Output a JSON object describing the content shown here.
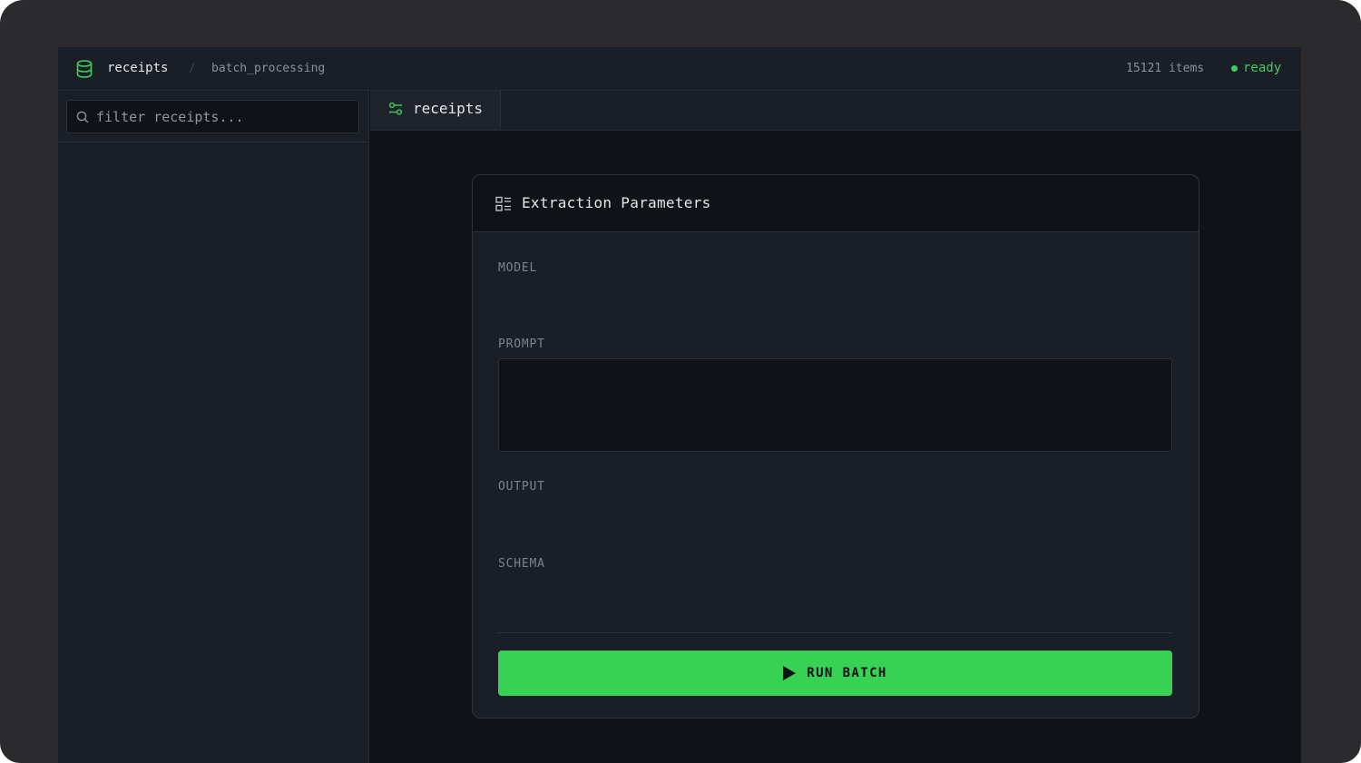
{
  "header": {
    "breadcrumb_root": "receipts",
    "breadcrumb_separator": "/",
    "breadcrumb_leaf": "batch_processing",
    "item_count": "15121 items",
    "status": "ready",
    "database_icon": "database-icon",
    "status_color": "#3ecf5a"
  },
  "sidebar": {
    "search_placeholder": "filter receipts...",
    "search_value": "",
    "search_icon": "search-icon"
  },
  "tabs": [
    {
      "label": "receipts",
      "icon": "sliders-icon",
      "active": true
    }
  ],
  "card": {
    "title": "Extraction Parameters",
    "icon": "form-list-icon",
    "fields": {
      "model_label": "MODEL",
      "prompt_label": "PROMPT",
      "prompt_value": "",
      "output_label": "OUTPUT",
      "schema_label": "SCHEMA"
    },
    "run_button_label": "RUN BATCH",
    "run_icon": "play-icon"
  },
  "colors": {
    "accent": "#37d153",
    "background": "#0f1216",
    "panel": "#1a1e26"
  }
}
